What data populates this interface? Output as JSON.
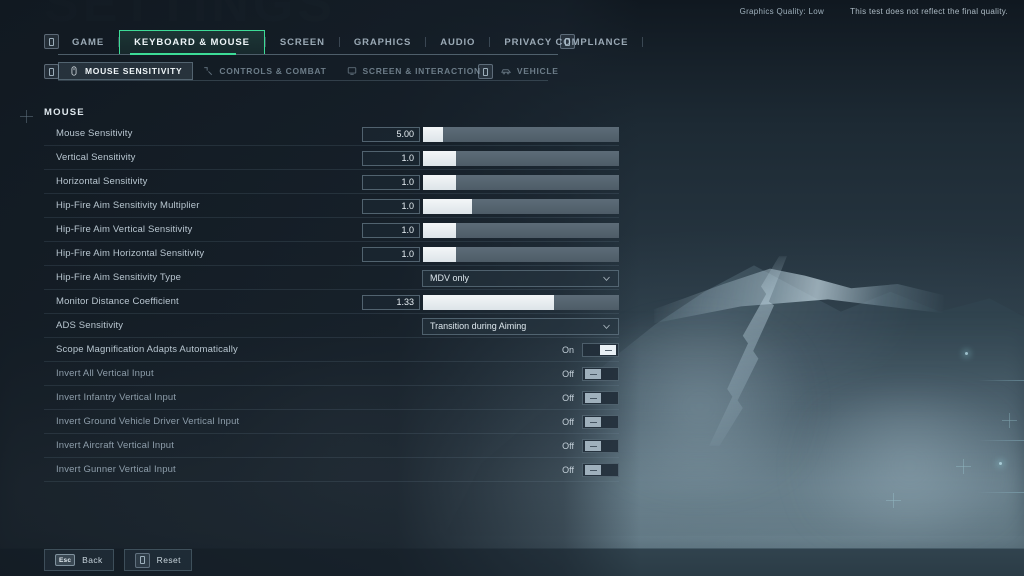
{
  "watermark": "SETTINGS",
  "status": {
    "graphics_quality": "Graphics Quality: Low",
    "disclaimer": "This test does not reflect the final quality."
  },
  "tabs": {
    "left_badge": "bumper-left",
    "right_badge": "bumper-right",
    "items": [
      {
        "label": "GAME",
        "active": false
      },
      {
        "label": "KEYBOARD & MOUSE",
        "active": true
      },
      {
        "label": "SCREEN",
        "active": false
      },
      {
        "label": "GRAPHICS",
        "active": false
      },
      {
        "label": "AUDIO",
        "active": false
      },
      {
        "label": "PRIVACY COMPLIANCE",
        "active": false
      }
    ]
  },
  "subtabs": {
    "items": [
      {
        "label": "MOUSE SENSITIVITY",
        "icon": "mouse-icon",
        "active": true
      },
      {
        "label": "CONTROLS & COMBAT",
        "icon": "crosshair-icon",
        "active": false
      },
      {
        "label": "SCREEN & INTERACTION",
        "icon": "screen-icon",
        "active": false
      },
      {
        "label": "VEHICLE",
        "icon": "vehicle-icon",
        "active": false
      }
    ]
  },
  "section": {
    "title": "MOUSE"
  },
  "rows": [
    {
      "label": "Mouse Sensitivity",
      "type": "slider",
      "value": "5.00",
      "fill": 10
    },
    {
      "label": "Vertical Sensitivity",
      "type": "slider",
      "value": "1.0",
      "fill": 17
    },
    {
      "label": "Horizontal Sensitivity",
      "type": "slider",
      "value": "1.0",
      "fill": 17
    },
    {
      "label": "Hip-Fire Aim Sensitivity Multiplier",
      "type": "slider",
      "value": "1.0",
      "fill": 25
    },
    {
      "label": "Hip-Fire Aim Vertical Sensitivity",
      "type": "slider",
      "value": "1.0",
      "fill": 17
    },
    {
      "label": "Hip-Fire Aim Horizontal Sensitivity",
      "type": "slider",
      "value": "1.0",
      "fill": 17
    },
    {
      "label": "Hip-Fire Aim Sensitivity Type",
      "type": "dropdown",
      "value": "MDV only"
    },
    {
      "label": "Monitor Distance Coefficient",
      "type": "slider",
      "value": "1.33",
      "fill": 67
    },
    {
      "label": "ADS Sensitivity",
      "type": "dropdown",
      "value": "Transition during Aiming"
    },
    {
      "label": "Scope Magnification Adapts Automatically",
      "type": "toggle",
      "value": "On",
      "on": true
    },
    {
      "label": "Invert All Vertical Input",
      "type": "toggle",
      "value": "Off",
      "on": false
    },
    {
      "label": "Invert Infantry Vertical Input",
      "type": "toggle",
      "value": "Off",
      "on": false
    },
    {
      "label": "Invert Ground Vehicle Driver Vertical Input",
      "type": "toggle",
      "value": "Off",
      "on": false
    },
    {
      "label": "Invert Aircraft Vertical Input",
      "type": "toggle",
      "value": "Off",
      "on": false
    },
    {
      "label": "Invert Gunner Vertical Input",
      "type": "toggle",
      "value": "Off",
      "on": false
    }
  ],
  "footer": {
    "back_key": "Esc",
    "back_label": "Back",
    "reset_key": "reset-key-icon",
    "reset_label": "Reset"
  },
  "colors": {
    "accent": "#3ddc97",
    "panel": "#111921",
    "text": "#b8c6d0"
  }
}
